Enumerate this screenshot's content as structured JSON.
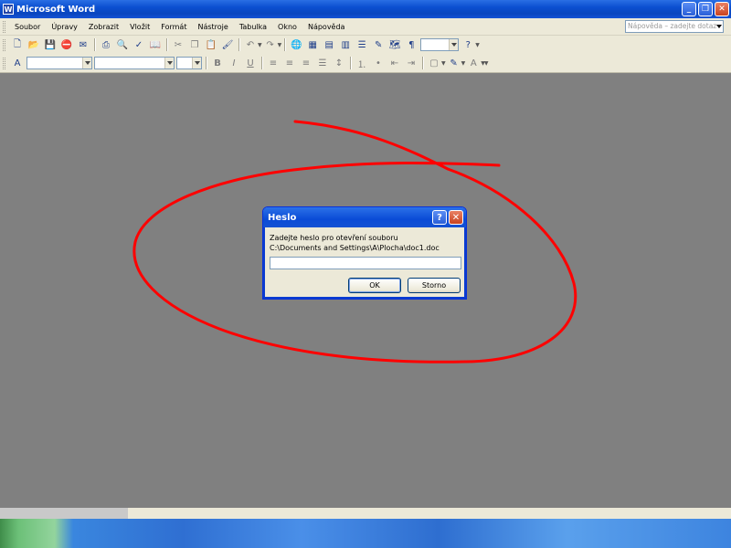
{
  "window": {
    "title": "Microsoft Word",
    "app_icon_letter": "W",
    "minimize_glyph": "_",
    "restore_glyph": "❐",
    "close_glyph": "✕"
  },
  "menu": {
    "items": [
      "Soubor",
      "Úpravy",
      "Zobrazit",
      "Vložit",
      "Formát",
      "Nástroje",
      "Tabulka",
      "Okno",
      "Nápověda"
    ]
  },
  "help_box": {
    "placeholder": "Nápověda – zadejte dotaz"
  },
  "toolbar": {
    "icons": [
      "new-icon",
      "open-icon",
      "save-icon",
      "permission-icon",
      "email-icon",
      "print-icon",
      "print-preview-icon",
      "spelling-icon",
      "research-icon",
      "cut-icon",
      "copy-icon",
      "paste-icon",
      "format-painter-icon",
      "undo-icon",
      "redo-icon",
      "hyperlink-icon",
      "tables-borders-icon",
      "insert-table-icon",
      "insert-excel-icon",
      "columns-icon",
      "drawing-icon",
      "document-map-icon",
      "show-formatting-icon",
      "zoom-field",
      "help-icon"
    ],
    "formatting_icons": [
      "styles-icon",
      "style-field",
      "font-field",
      "font-size-field",
      "bold-icon",
      "italic-icon",
      "underline-icon",
      "align-left-icon",
      "center-icon",
      "align-right-icon",
      "justify-icon",
      "line-spacing-icon",
      "numbering-icon",
      "bullets-icon",
      "decrease-indent-icon",
      "increase-indent-icon",
      "border-icon",
      "highlight-icon",
      "font-color-icon"
    ]
  },
  "dialog": {
    "title": "Heslo",
    "help_glyph": "?",
    "close_glyph": "✕",
    "prompt": "Zadejte heslo pro otevření souboru",
    "path": "C:\\Documents and Settings\\A\\Plocha\\doc1.doc",
    "password_value": "",
    "ok_label": "OK",
    "cancel_label": "Storno"
  },
  "annotation": {
    "color": "#ff0000"
  },
  "colors": {
    "titlebar": "#0b4fd0",
    "workspace": "#808080",
    "chrome": "#ece9d8"
  }
}
